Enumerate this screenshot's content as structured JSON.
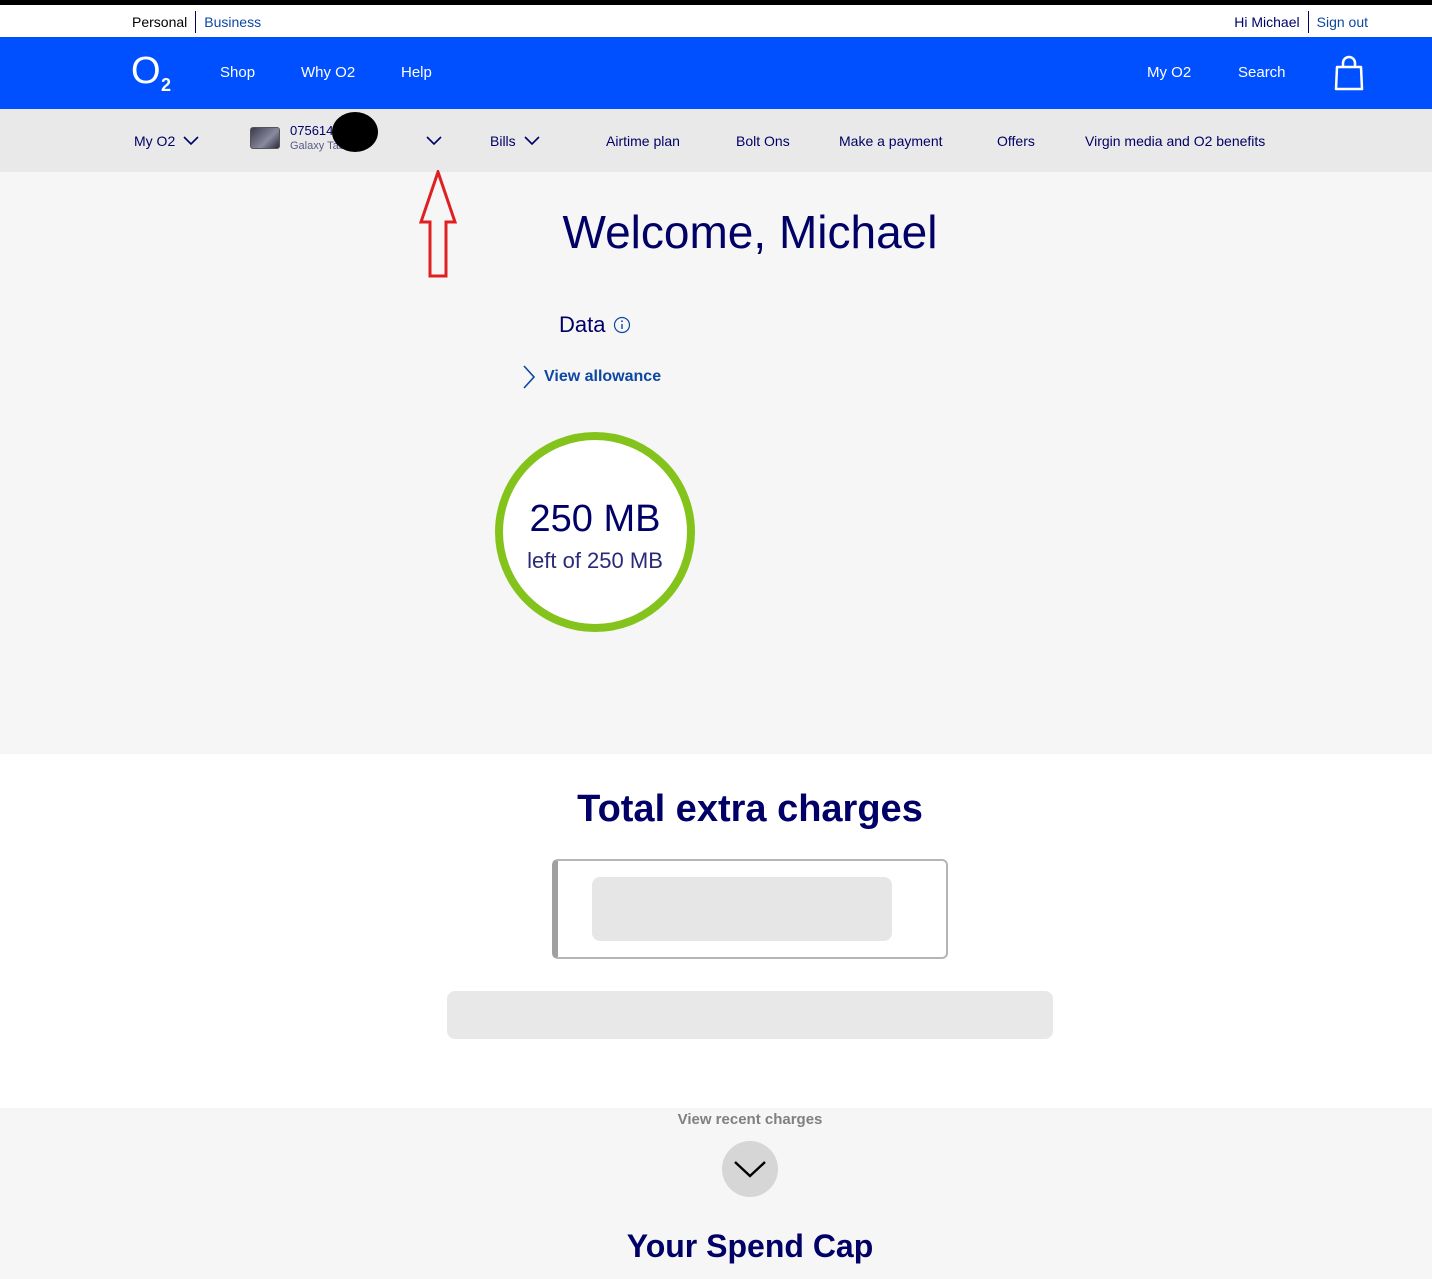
{
  "utility": {
    "personal": "Personal",
    "business": "Business",
    "greeting": "Hi Michael",
    "sign_out": "Sign out"
  },
  "mainnav": {
    "logo": "O2",
    "logo_sub": "2",
    "shop": "Shop",
    "why_o2": "Why O2",
    "help": "Help",
    "my_o2": "My O2",
    "search": "Search"
  },
  "subnav": {
    "my_o2": "My O2",
    "device_number": "075614",
    "device_model": "Galaxy Tab",
    "bills": "Bills",
    "airtime_plan": "Airtime plan",
    "bolt_ons": "Bolt Ons",
    "make_payment": "Make a payment",
    "offers": "Offers",
    "benefits": "Virgin media and O2 benefits"
  },
  "main": {
    "welcome": "Welcome, Michael",
    "data_label": "Data",
    "view_allowance": "View allowance",
    "data_remaining": "250 MB",
    "data_of": "left of 250 MB",
    "ring_color": "#84c31b"
  },
  "charges": {
    "title": "Total extra charges",
    "view_recent": "View recent charges",
    "spend_cap_title": "Your Spend Cap"
  },
  "colors": {
    "brand_blue": "#0050ff",
    "navy_text": "#000066",
    "link_blue": "#0d47a1",
    "annotation_red": "#e02020"
  },
  "icons": {
    "logo": "o2-logo",
    "bag": "shopping-bag-icon",
    "chevron": "chevron-down-icon",
    "info": "info-icon",
    "arrow_right": "chevron-right-icon",
    "annotation": "red-arrow-annotation"
  }
}
